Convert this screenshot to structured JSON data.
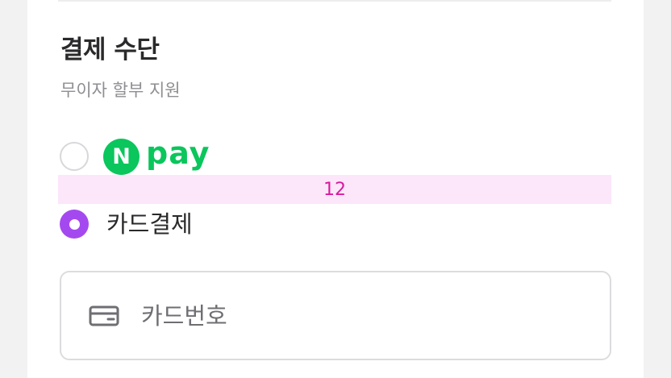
{
  "payment": {
    "title": "결제 수단",
    "subtitle": "무이자 할부 지원",
    "options": [
      {
        "id": "npay",
        "badge_letter": "N",
        "brand_text": "pay",
        "selected": false,
        "brand_color": "#0AC65C"
      },
      {
        "id": "card",
        "label": "카드결제",
        "selected": true,
        "accent_color": "#A449F0"
      }
    ],
    "spacing_guide_label": "12",
    "card_number_field": {
      "placeholder": "카드번호",
      "icon": "credit-card-icon"
    }
  }
}
